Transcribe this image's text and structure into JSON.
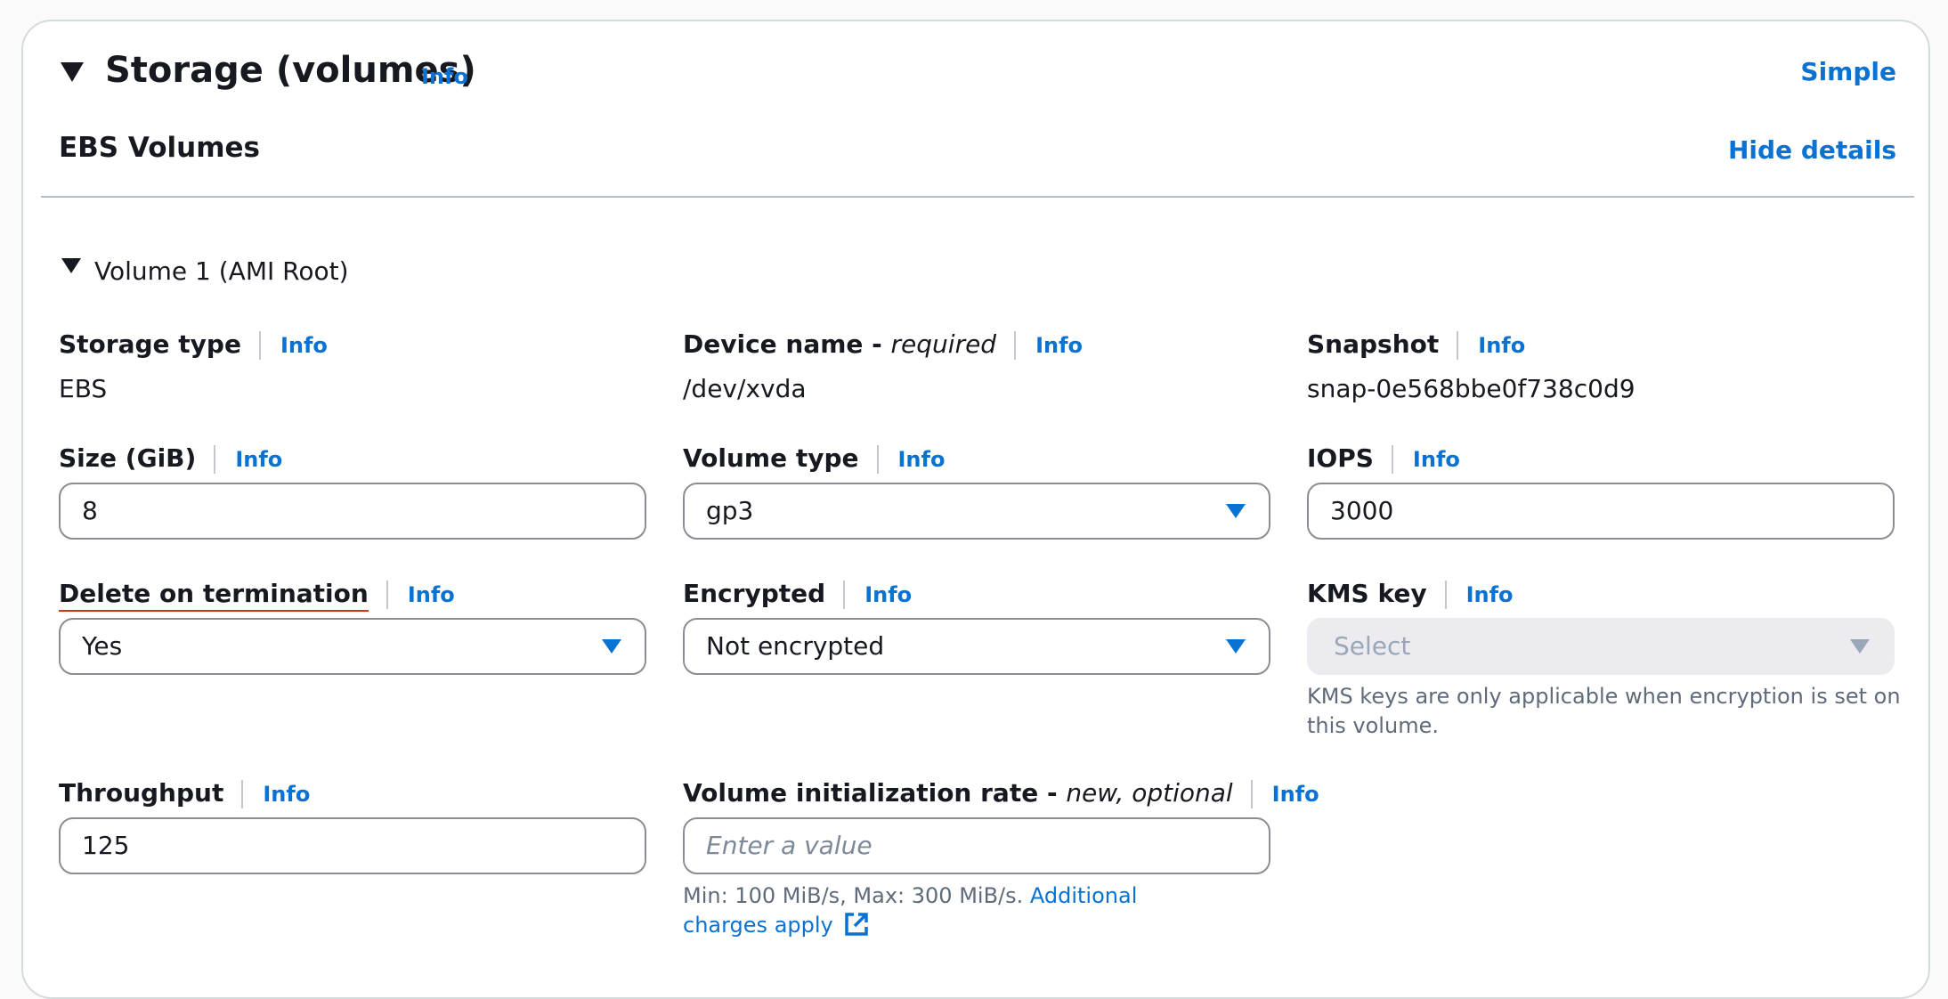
{
  "header": {
    "title": "Storage (volumes)",
    "info_label": "Info",
    "simple_label": "Simple"
  },
  "ebs": {
    "title": "EBS Volumes",
    "hide_details_label": "Hide details"
  },
  "volume": {
    "title": "Volume 1 (AMI Root)",
    "storage_type": {
      "label": "Storage type",
      "info": "Info",
      "value": "EBS"
    },
    "device_name": {
      "label": "Device name - ",
      "label_suffix": "required",
      "info": "Info",
      "value": "/dev/xvda"
    },
    "snapshot": {
      "label": "Snapshot",
      "info": "Info",
      "value": "snap-0e568bbe0f738c0d9"
    },
    "size": {
      "label": "Size (GiB)",
      "info": "Info",
      "value": "8"
    },
    "volume_type": {
      "label": "Volume type",
      "info": "Info",
      "value": "gp3"
    },
    "iops": {
      "label": "IOPS",
      "info": "Info",
      "value": "3000"
    },
    "delete_on_termination": {
      "label": "Delete on termination",
      "info": "Info",
      "value": "Yes"
    },
    "encrypted": {
      "label": "Encrypted",
      "info": "Info",
      "value": "Not encrypted"
    },
    "kms_key": {
      "label": "KMS key",
      "info": "Info",
      "placeholder": "Select",
      "hint": "KMS keys are only applicable when encryption is set on this volume."
    },
    "throughput": {
      "label": "Throughput",
      "info": "Info",
      "value": "125"
    },
    "init_rate": {
      "label": "Volume initialization rate - ",
      "label_suffix": "new, optional",
      "info": "Info",
      "placeholder": "Enter a value",
      "hint": "Min: 100 MiB/s, Max: 300 MiB/s. ",
      "hint_link": "Additional charges apply"
    }
  },
  "colors": {
    "link": "#0972d3",
    "text": "#16191f",
    "muted": "#5f6b7a",
    "border": "#8c8c94"
  }
}
